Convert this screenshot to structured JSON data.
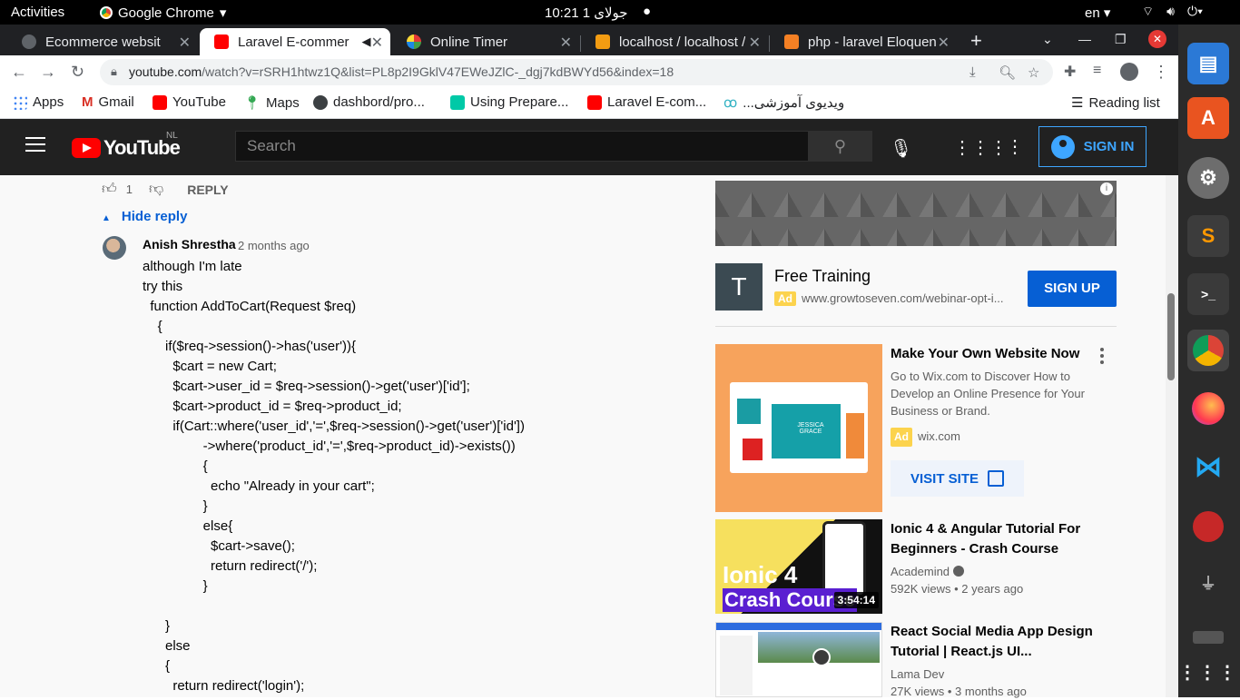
{
  "os": {
    "activities": "Activities",
    "app_name": "Google Chrome",
    "clock": "10:21  جولای 1",
    "language": "en"
  },
  "tabs": [
    {
      "title": "Ecommerce websit",
      "close": "✕"
    },
    {
      "title": "Laravel E-commer",
      "close": "✕"
    },
    {
      "title": "Online Timer",
      "close": "✕"
    },
    {
      "title": "localhost / localhost /",
      "close": "✕"
    },
    {
      "title": "php - laravel Eloquen",
      "close": "✕"
    }
  ],
  "new_tab": "+",
  "address": {
    "host": "youtube.com",
    "path": "/watch?v=rSRH1htwz1Q&list=PL8p2I9GklV47EWeJZlC-_dgj7kdBWYd56&index=18"
  },
  "bookmarks": [
    {
      "label": "Apps"
    },
    {
      "label": "Gmail"
    },
    {
      "label": "YouTube"
    },
    {
      "label": "Maps"
    },
    {
      "label": "dashbord/pro..."
    },
    {
      "label": "Using Prepare..."
    },
    {
      "label": "Laravel E-com..."
    },
    {
      "label": "...ویدیوی آموزشی"
    }
  ],
  "reading_list": "Reading list",
  "youtube": {
    "logo_text": "YouTube",
    "country": "NL",
    "search_placeholder": "Search",
    "sign_in": "SIGN IN"
  },
  "comment": {
    "likes": "1",
    "reply": "REPLY",
    "hide_reply": "Hide reply",
    "author": "Anish Shrestha",
    "age": "2 months ago",
    "lines": [
      "although I'm late",
      "try this",
      "  function AddToCart(Request $req)",
      "    {",
      "      if($req->session()->has('user')){",
      "        $cart = new Cart;",
      "        $cart->user_id = $req->session()->get('user')['id'];",
      "        $cart->product_id = $req->product_id;",
      "        if(Cart::where('user_id','=',$req->session()->get('user')['id'])",
      "                ->where('product_id','=',$req->product_id)->exists())",
      "                {",
      "                  echo \"Already in your cart\";",
      "                }",
      "                else{",
      "                  $cart->save();",
      "                  return redirect('/');",
      "                }",
      "",
      "      }",
      "      else",
      "      {",
      "        return redirect('login');"
    ]
  },
  "sidebar": {
    "ad": {
      "logo_letter": "T",
      "title": "Free Training",
      "tag": "Ad",
      "domain": "www.growtoseven.com/webinar-opt-i...",
      "cta": "SIGN UP"
    },
    "wix": {
      "title": "Make Your Own Website Now",
      "description": "Go to Wix.com to Discover How to Develop an Online Presence for Your Business or Brand.",
      "tag": "Ad",
      "domain": "wix.com",
      "cta": "VISIT SITE",
      "thumb_text": "JESSICA GRACE"
    },
    "videos": [
      {
        "title": "Ionic 4 & Angular Tutorial For Beginners - Crash Course",
        "channel": "Academind",
        "meta": "592K views • 2 years ago",
        "duration": "3:54:14",
        "thumb_line1": "Ionic 4",
        "thumb_line2": "Crash Course"
      },
      {
        "title": "React Social Media App Design Tutorial | React.js UI...",
        "channel": "Lama Dev",
        "meta": "27K views • 3 months ago"
      }
    ]
  }
}
